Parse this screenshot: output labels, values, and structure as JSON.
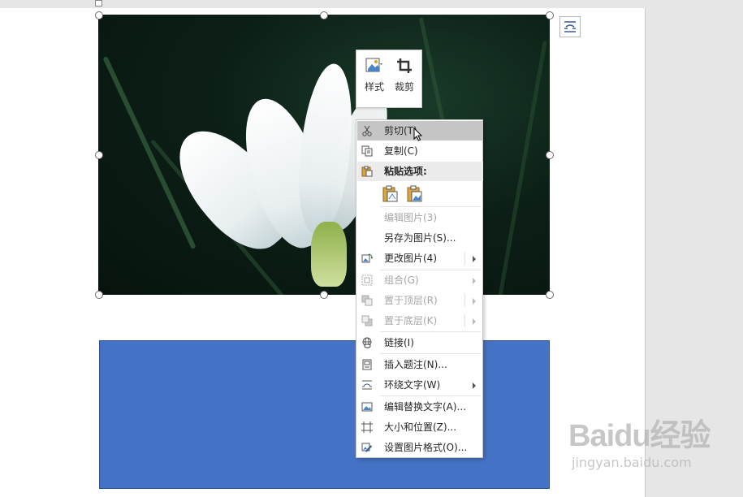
{
  "mini_toolbar": {
    "style_label": "样式",
    "crop_label": "裁剪"
  },
  "context_menu": {
    "cut": "剪切(T)",
    "copy": "复制(C)",
    "paste_options": "粘贴选项:",
    "edit_picture": "编辑图片(3)",
    "save_as_picture": "另存为图片(S)...",
    "change_picture": "更改图片(4)",
    "group": "组合(G)",
    "bring_to_front": "置于顶层(R)",
    "send_to_back": "置于底层(K)",
    "link": "链接(I)",
    "insert_caption": "插入题注(N)...",
    "wrap_text": "环绕文字(W)",
    "edit_alt_text": "编辑替换文字(A)...",
    "size_and_position": "大小和位置(Z)...",
    "format_picture": "设置图片格式(O)..."
  },
  "watermark": {
    "logo": "Baidu经验",
    "url": "jingyan.baidu.com"
  },
  "colors": {
    "shape_fill": "#4472c4",
    "menu_highlight": "#c5c5c5"
  }
}
